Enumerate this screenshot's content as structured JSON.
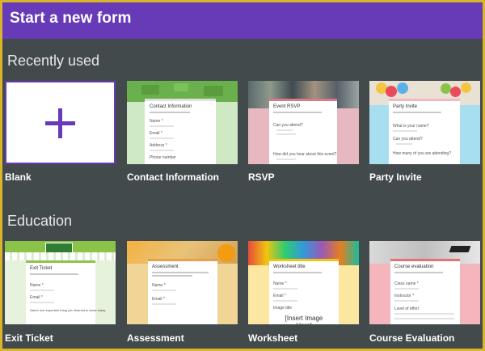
{
  "header": {
    "title": "Start a new form"
  },
  "sections": [
    {
      "title": "Recently used",
      "cards": [
        {
          "label": "Blank"
        },
        {
          "label": "Contact Information",
          "preview_title": "Contact Information",
          "fields": [
            "Name *",
            "Email *",
            "Address *",
            "Phone number"
          ]
        },
        {
          "label": "RSVP",
          "preview_title": "Event RSVP",
          "fields": [
            "Can you attend?",
            "How did you hear about this event?"
          ]
        },
        {
          "label": "Party Invite",
          "preview_title": "Party Invite",
          "fields": [
            "What is your name?",
            "Can you attend?",
            "How many of you are attending?"
          ]
        }
      ]
    },
    {
      "title": "Education",
      "cards": [
        {
          "label": "Exit Ticket",
          "preview_title": "Exit Ticket",
          "fields": [
            "Name *",
            "Email *",
            "Name one important thing you learned in class today."
          ]
        },
        {
          "label": "Assessment",
          "preview_title": "Assessment",
          "fields": [
            "Name *",
            "Email *"
          ]
        },
        {
          "label": "Worksheet",
          "preview_title": "Worksheet title",
          "fields": [
            "Name *",
            "Email *",
            "Image title"
          ],
          "image_placeholder": "[Insert Image Here]"
        },
        {
          "label": "Course Evaluation",
          "preview_title": "Course evaluation",
          "fields": [
            "Class name *",
            "Instructor *",
            "Level of effort"
          ]
        }
      ]
    }
  ],
  "colors": {
    "header": "#673ab7",
    "background": "#434a4c",
    "frame": "#d9b52a",
    "contact": "#6ab04c",
    "rsvp": "#e8b8c0",
    "party": "#a8dff0",
    "exit": "#8bc34a",
    "assessment": "#f0d596",
    "worksheet": "#fbe7a0",
    "course": "#f4b6bc"
  }
}
